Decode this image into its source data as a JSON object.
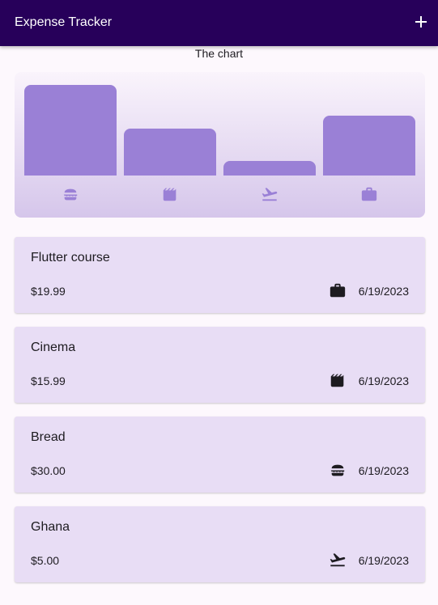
{
  "app_bar": {
    "title": "Expense Tracker",
    "add_icon": "add-icon"
  },
  "chart": {
    "caption": "The chart",
    "bar_color": "#9a80d6",
    "categories": [
      {
        "icon": "food-icon",
        "fill": 1.0
      },
      {
        "icon": "movie-icon",
        "fill": 0.52
      },
      {
        "icon": "flight-icon",
        "fill": 0.16
      },
      {
        "icon": "work-icon",
        "fill": 0.66
      }
    ]
  },
  "expenses": [
    {
      "title": "Flutter course",
      "amount": "$19.99",
      "date": "6/19/2023",
      "icon": "work-icon"
    },
    {
      "title": "Cinema",
      "amount": "$15.99",
      "date": "6/19/2023",
      "icon": "movie-icon"
    },
    {
      "title": "Bread",
      "amount": "$30.00",
      "date": "6/19/2023",
      "icon": "food-icon"
    },
    {
      "title": "Ghana",
      "amount": "$5.00",
      "date": "6/19/2023",
      "icon": "flight-icon"
    }
  ],
  "colors": {
    "app_bar": "#27005a",
    "card": "#e8ddf5",
    "icon_chart": "#9a80d6",
    "icon_list": "#1d1b20"
  }
}
